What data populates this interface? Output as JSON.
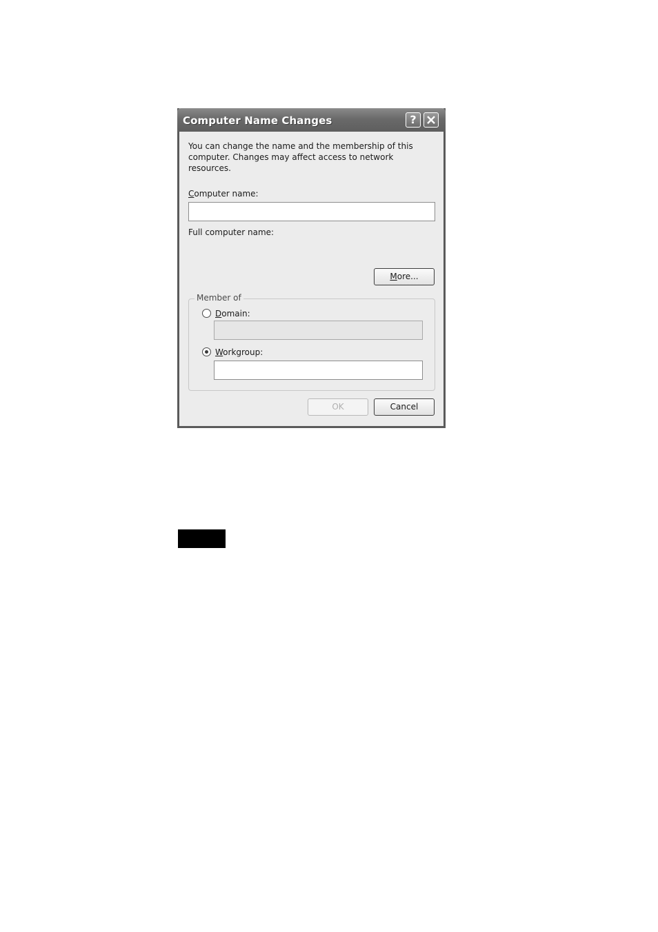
{
  "dialog": {
    "title": "Computer Name Changes",
    "help_button": "?",
    "description": "You can change the name and the membership of this computer. Changes may affect access to network resources.",
    "computer_name": {
      "label_first": "C",
      "label_rest": "omputer name:",
      "value": ""
    },
    "full_computer_name": {
      "label": "Full computer name:",
      "value": ""
    },
    "more_button": {
      "label_first": "M",
      "label_rest": "ore..."
    },
    "member_of": {
      "legend": "Member of",
      "domain": {
        "label_first": "D",
        "label_rest": "omain:",
        "selected": false,
        "value": ""
      },
      "workgroup": {
        "label_first": "W",
        "label_rest": "orkgroup:",
        "selected": true,
        "value": ""
      }
    },
    "ok_button": "OK",
    "cancel_button": "Cancel"
  },
  "colors": {
    "titlebar": "#6a6a6a",
    "dialog_background": "#ececec",
    "black_bar": "#000000"
  }
}
